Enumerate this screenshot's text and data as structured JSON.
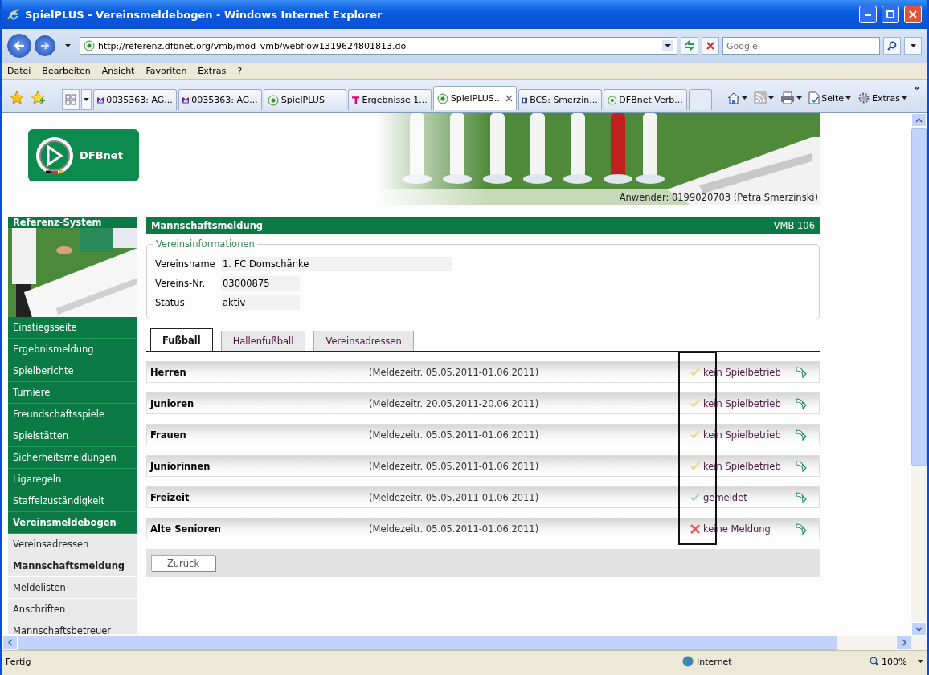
{
  "window": {
    "title": "SpielPLUS - Vereinsmeldebogen - Windows Internet Explorer"
  },
  "address_bar": {
    "url": "http://referenz.dfbnet.org/vmb/mod_vmb/webflow1319624801813.do",
    "search_placeholder": "Google"
  },
  "menu": [
    "Datei",
    "Bearbeiten",
    "Ansicht",
    "Favoriten",
    "Extras",
    "?"
  ],
  "browser_tabs": [
    {
      "label": "0035363: AG...",
      "selected": false
    },
    {
      "label": "0035363: AG...",
      "selected": false
    },
    {
      "label": "SpielPLUS",
      "selected": false
    },
    {
      "label": "Ergebnisse 1...",
      "selected": false
    },
    {
      "label": "SpielPLUS...",
      "selected": true
    },
    {
      "label": "BCS: Smerzin...",
      "selected": false
    },
    {
      "label": "DFBnet Verb...",
      "selected": false
    }
  ],
  "command_bar": {
    "page_label": "Seite",
    "tools_label": "Extras",
    "more": "»"
  },
  "header": {
    "logo": "DFBnet",
    "user": "Anwender: 0199020703 (Petra Smerzinski)"
  },
  "sidebar": {
    "title": "Referenz-System",
    "items": [
      {
        "label": "Einstiegsseite",
        "kind": "nav",
        "selected": false
      },
      {
        "label": "Ergebnismeldung",
        "kind": "nav",
        "selected": false
      },
      {
        "label": "Spielberichte",
        "kind": "nav",
        "selected": false
      },
      {
        "label": "Turniere",
        "kind": "nav",
        "selected": false
      },
      {
        "label": "Freundschaftsspiele",
        "kind": "nav",
        "selected": false
      },
      {
        "label": "Spielstätten",
        "kind": "nav",
        "selected": false
      },
      {
        "label": "Sicherheitsmeldungen",
        "kind": "nav",
        "selected": false
      },
      {
        "label": "Ligaregeln",
        "kind": "nav",
        "selected": false
      },
      {
        "label": "Staffelzuständigkeit",
        "kind": "nav",
        "selected": false
      },
      {
        "label": "Vereinsmeldebogen",
        "kind": "nav",
        "selected": true
      },
      {
        "label": "Vereinsadressen",
        "kind": "sub",
        "selected": false
      },
      {
        "label": "Mannschaftsmeldung",
        "kind": "sub",
        "selected": true
      },
      {
        "label": "Meldelisten",
        "kind": "sub",
        "selected": false
      },
      {
        "label": "Anschriften",
        "kind": "sub",
        "selected": false
      },
      {
        "label": "Mannschaftsbetreuer",
        "kind": "sub",
        "selected": false
      }
    ]
  },
  "panel": {
    "title": "Mannschaftsmeldung",
    "code": "VMB 106",
    "club_info": {
      "legend": "Vereinsinformationen",
      "fields": [
        {
          "label": "Vereinsname",
          "value": "1. FC Domschänke"
        },
        {
          "label": "Vereins-Nr.",
          "value": "03000875"
        },
        {
          "label": "Status",
          "value": "aktiv"
        }
      ]
    },
    "tabs": [
      {
        "label": "Fußball",
        "selected": true
      },
      {
        "label": "Hallenfußball",
        "selected": false
      },
      {
        "label": "Vereinsadressen",
        "selected": false
      }
    ],
    "teams": [
      {
        "name": "Herren",
        "period": "(Meldezeitr. 05.05.2011-01.06.2011)",
        "status": "kein Spielbetrieb",
        "kind": "none"
      },
      {
        "name": "Junioren",
        "period": "(Meldezeitr. 20.05.2011-20.06.2011)",
        "status": "kein Spielbetrieb",
        "kind": "none"
      },
      {
        "name": "Frauen",
        "period": "(Meldezeitr. 05.05.2011-01.06.2011)",
        "status": "kein Spielbetrieb",
        "kind": "none"
      },
      {
        "name": "Juniorinnen",
        "period": "(Meldezeitr. 05.05.2011-01.06.2011)",
        "status": "kein Spielbetrieb",
        "kind": "none"
      },
      {
        "name": "Freizeit",
        "period": "(Meldezeitr. 05.05.2011-01.06.2011)",
        "status": "gemeldet",
        "kind": "registered"
      },
      {
        "name": "Alte Senioren",
        "period": "(Meldezeitr. 05.05.2011-01.06.2011)",
        "status": "keine Meldung",
        "kind": "missing"
      }
    ],
    "back_button": "Zurück"
  },
  "status_bar": {
    "text": "Fertig",
    "zone": "Internet",
    "zoom": "100%"
  }
}
